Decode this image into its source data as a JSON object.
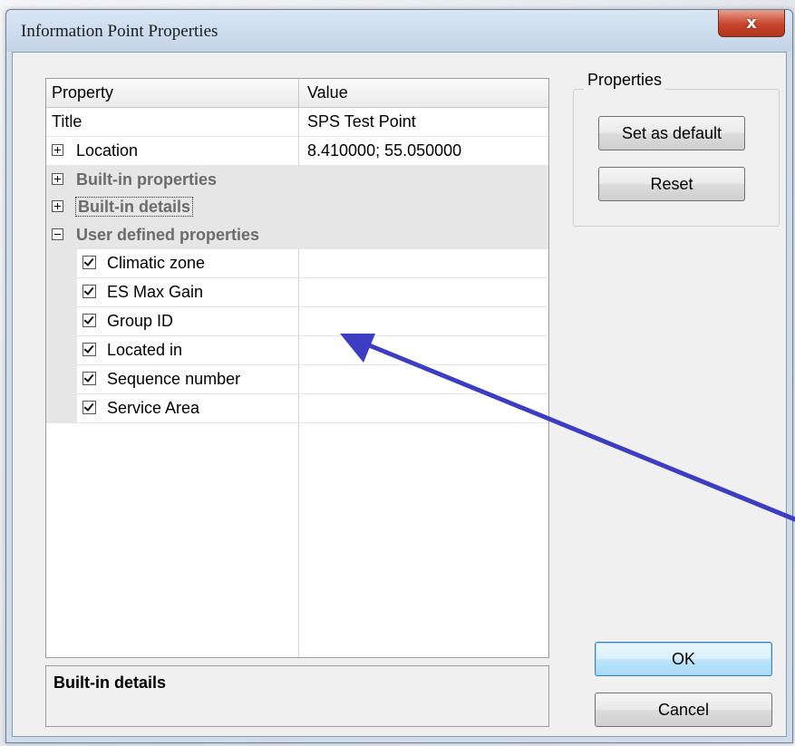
{
  "window": {
    "title": "Information Point Properties",
    "close_label": "x"
  },
  "grid": {
    "columns": [
      "Property",
      "Value"
    ],
    "rows": [
      {
        "property": "Title",
        "value": "SPS Test Point"
      },
      {
        "property": "Location",
        "value": "8.410000; 55.050000"
      }
    ],
    "categories": [
      {
        "label": "Built-in properties",
        "expanded": false
      },
      {
        "label": "Built-in details",
        "expanded": false
      },
      {
        "label": "User defined properties",
        "expanded": true
      }
    ],
    "user_defined": [
      {
        "label": "Climatic zone",
        "checked": true
      },
      {
        "label": "ES Max Gain",
        "checked": true
      },
      {
        "label": "Group ID",
        "checked": true
      },
      {
        "label": "Located in",
        "checked": true
      },
      {
        "label": "Sequence number",
        "checked": true
      },
      {
        "label": "Service Area",
        "checked": true
      }
    ]
  },
  "description": {
    "title": "Built-in details"
  },
  "properties_group": {
    "label": "Properties",
    "set_default_label": "Set as default",
    "reset_label": "Reset"
  },
  "footer": {
    "ok_label": "OK",
    "cancel_label": "Cancel"
  },
  "colors": {
    "annotation_arrow": "#3d3dc4",
    "close_button": "#c7442b",
    "category_text": "#6b6b6b"
  }
}
